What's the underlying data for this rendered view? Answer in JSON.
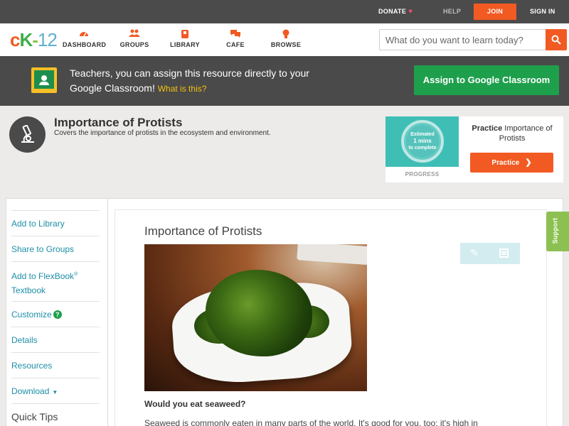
{
  "topbar": {
    "donate": "DONATE",
    "help": "HELP",
    "join": "JOIN",
    "signin": "SIGN IN"
  },
  "logo": {
    "c": "c",
    "k": "K",
    "dash": "-",
    "num": "12"
  },
  "nav": {
    "dashboard": "DASHBOARD",
    "groups": "GROUPS",
    "library": "LIBRARY",
    "cafe": "CAFE",
    "browse": "BROWSE"
  },
  "search": {
    "placeholder": "What do you want to learn today?"
  },
  "google_banner": {
    "text": "Teachers, you can assign this resource directly to your Google Classroom!",
    "link": "What is this?",
    "button": "Assign to Google Classroom"
  },
  "header": {
    "title": "Importance of Protists",
    "description": "Covers the importance of protists in the ecosystem and environment."
  },
  "practice": {
    "estimated": "Estimated",
    "mins": "1 mins",
    "to_complete": "to complete",
    "progress_label": "PROGRESS",
    "practice_word": "Practice",
    "practice_title": "Importance of Protists",
    "button": "Practice"
  },
  "sidebar": {
    "add_library": "Add to Library",
    "share_groups": "Share to Groups",
    "add_flexbook": "Add to FlexBook",
    "reg": "®",
    "textbook": "Textbook",
    "customize": "Customize",
    "qmark": "?",
    "details": "Details",
    "resources": "Resources",
    "download": "Download",
    "caret": "▼",
    "quick_tips": "Quick Tips"
  },
  "article": {
    "title": "Importance of Protists",
    "question": "Would you eat seaweed?",
    "body": "Seaweed is commonly eaten in many parts of the world. It's good for you, too; it's high in"
  },
  "support": "Support",
  "colors": {
    "accent": "#f15a22",
    "green": "#1e9f4c",
    "link": "#1e8ea8"
  }
}
